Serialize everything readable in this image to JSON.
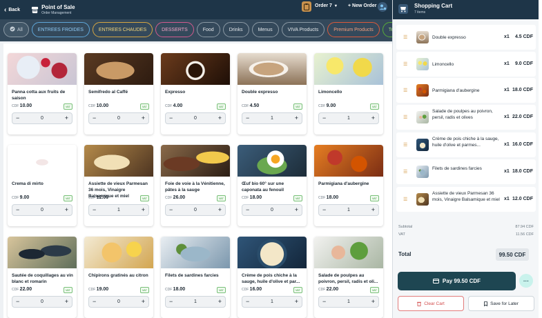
{
  "header": {
    "back_label": "Back",
    "app_title": "Point of Sale",
    "app_subtitle": "Order Management",
    "order_label": "Order 7",
    "new_order_label": "+ New Order"
  },
  "filters": [
    {
      "label": "All",
      "style": "all"
    },
    {
      "label": "ENTREES FROIDES",
      "style": "blue"
    },
    {
      "label": "ENTREES CHAUDES",
      "style": "yellow"
    },
    {
      "label": "DESSERTS",
      "style": "pink"
    },
    {
      "label": "Food",
      "style": "gray"
    },
    {
      "label": "Drinks",
      "style": "gray"
    },
    {
      "label": "Menus",
      "style": "gray"
    },
    {
      "label": "VIVA Products",
      "style": "gray"
    },
    {
      "label": "Premium Products",
      "style": "orange"
    },
    {
      "label": "Temp Menu",
      "style": "green"
    }
  ],
  "products": [
    {
      "name": "Panna cotta aux fruits de saison",
      "price": "10.00",
      "qty": "0",
      "img": "panna-cotta"
    },
    {
      "name": "Semifredo al Caffé",
      "price": "10.00",
      "qty": "0",
      "img": "semifreddo"
    },
    {
      "name": "Expresso",
      "price": "4.00",
      "qty": "0",
      "img": "expresso"
    },
    {
      "name": "Double expresso",
      "price": "4.50",
      "qty": "1",
      "img": "double-expresso"
    },
    {
      "name": "Limoncello",
      "price": "9.00",
      "qty": "1",
      "img": "limoncello"
    },
    {
      "name": "Crema di mirto",
      "price": "9.00",
      "qty": "0",
      "img": "crema-mirto"
    },
    {
      "name": "Assiette de vieux Parmesan 36 mois, Vinaigre Balsamique et miel",
      "price": "12.00",
      "qty": "1",
      "img": "parmesan"
    },
    {
      "name": "Foie de voie à la Vénitienne, pâtes à la sauge",
      "price": "26.00",
      "qty": "0",
      "img": "foie"
    },
    {
      "name": "Œuf bio 60° sur une caponata au fenouil",
      "price": "18.00",
      "qty": "0",
      "img": "oeuf"
    },
    {
      "name": "Parmigiana d'aubergine",
      "price": "18.00",
      "qty": "1",
      "img": "parmigiana"
    },
    {
      "name": "Sautée de coquillages au vin blanc et romarin",
      "price": "22.00",
      "qty": "0",
      "img": "coquillages"
    },
    {
      "name": "Chipirons gratinés au citron",
      "price": "19.00",
      "qty": "0",
      "img": "chipirons"
    },
    {
      "name": "Filets de sardines farcies",
      "price": "18.00",
      "qty": "1",
      "img": "sardines"
    },
    {
      "name": "Crème de pois chiche à la sauge, huile d'olive et par...",
      "price": "16.00",
      "qty": "1",
      "img": "pois-chiche"
    },
    {
      "name": "Salade de poulpes au poivron, persil, radis et oli...",
      "price": "22.00",
      "qty": "1",
      "img": "poulpes"
    }
  ],
  "currency_label": "CDF",
  "vat_label": "VAT",
  "cart": {
    "title": "Shopping Cart",
    "count": "7 items",
    "items": [
      {
        "name": "Double expresso",
        "qty": "x1",
        "amount": "4.5 CDF",
        "img": "double-expresso"
      },
      {
        "name": "Limoncello",
        "qty": "x1",
        "amount": "9.0 CDF",
        "img": "limoncello"
      },
      {
        "name": "Parmigiana d'aubergine",
        "qty": "x1",
        "amount": "18.0 CDF",
        "img": "parmigiana"
      },
      {
        "name": "Salade de poulpes au poivron, persil, radis et olives",
        "qty": "x1",
        "amount": "22.0 CDF",
        "img": "poulpes"
      },
      {
        "name": "Crème de pois chiche à la sauge, huile d'olive et parmes...",
        "qty": "x1",
        "amount": "16.0 CDF",
        "img": "pois-chiche"
      },
      {
        "name": "Filets de sardines farcies",
        "qty": "x1",
        "amount": "18.0 CDF",
        "img": "sardines"
      },
      {
        "name": "Assiette de vieux Parmesan 36 mois, Vinaigre Balsamique et miel",
        "qty": "x1",
        "amount": "12.0 CDF",
        "img": "parmesan"
      }
    ],
    "subtotal_label": "Subtotal",
    "subtotal_value": "87.94 CDF",
    "vat_label": "VAT",
    "vat_value": "11.56 CDF",
    "total_label": "Total",
    "total_value": "99.50 CDF",
    "pay_label": "Pay 99.50 CDF",
    "more_label": "···",
    "clear_label": "Clear Cart",
    "save_label": "Save for Later"
  },
  "colors": {
    "header_bg": "#1e3548",
    "filter_bg": "#34495b",
    "pay_bg": "#1e4652",
    "accent_orange": "#d2953f",
    "vat_green": "#3c9a3c"
  }
}
